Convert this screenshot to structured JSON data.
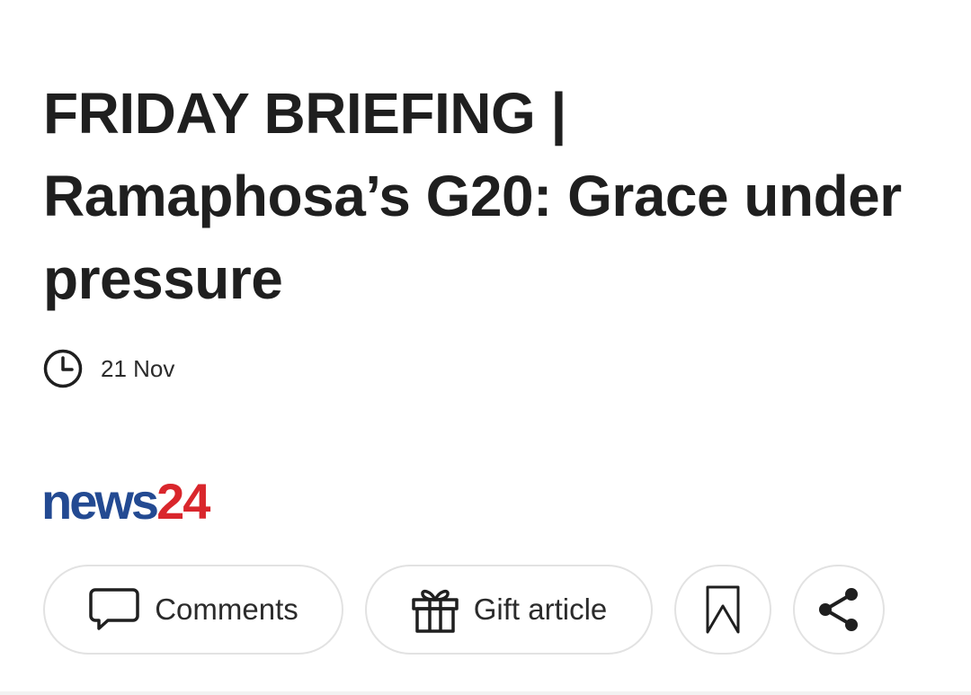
{
  "article": {
    "headline": "FRIDAY BRIEFING | Ramaphosa’s G20: Grace under pressure",
    "date": "21 Nov",
    "meta_icon": "clock-icon"
  },
  "brand": {
    "logo_part1": "news",
    "logo_part2": "24",
    "colors": {
      "news": "#234a92",
      "24": "#d9262c"
    }
  },
  "actions": {
    "comments_label": "Comments",
    "comments_icon": "speech-bubble-icon",
    "gift_label": "Gift article",
    "gift_icon": "gift-icon",
    "bookmark_icon": "bookmark-icon",
    "share_icon": "share-icon"
  }
}
